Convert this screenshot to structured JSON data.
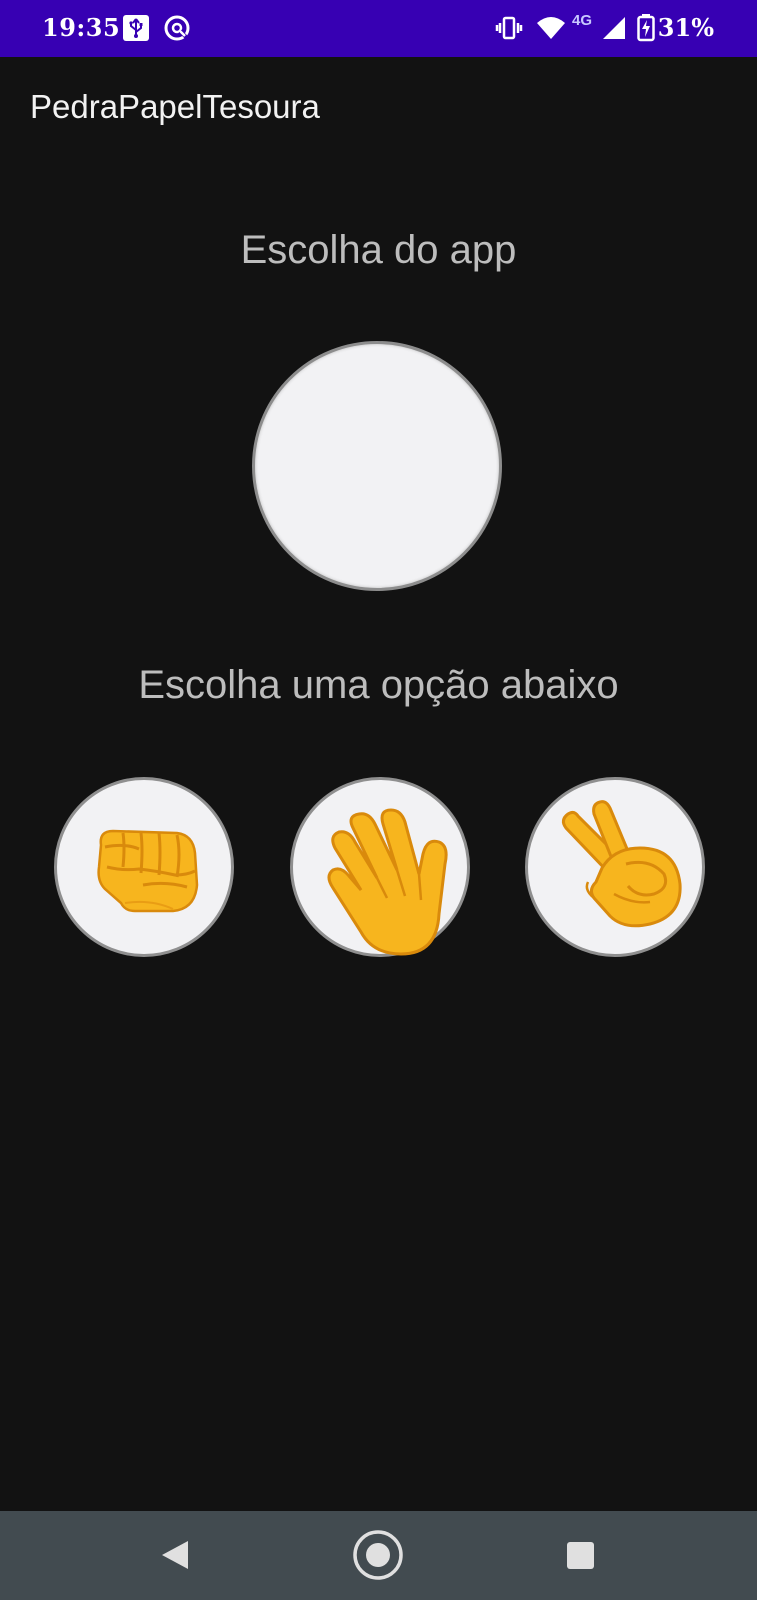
{
  "status_bar": {
    "time": "19:35",
    "battery_percent": "31%",
    "network_label": "4G",
    "background_color": "#3700b3",
    "icons": [
      "usb-icon",
      "sync-icon",
      "vibrate-icon",
      "wifi-icon",
      "cellular-signal-icon",
      "battery-charging-icon"
    ]
  },
  "app_bar": {
    "title": "PedraPapelTesoura"
  },
  "main": {
    "app_choice_heading": "Escolha do app",
    "app_choice_image": "empty-choice",
    "user_choice_heading": "Escolha uma opção abaixo",
    "options": [
      {
        "name": "rock-option",
        "icon": "fist-icon"
      },
      {
        "name": "paper-option",
        "icon": "open-hand-icon"
      },
      {
        "name": "scissors-option",
        "icon": "victory-hand-icon"
      }
    ]
  },
  "nav_bar": {
    "buttons": [
      "back-icon",
      "home-icon",
      "recents-icon"
    ],
    "background_color": "#424b50"
  }
}
